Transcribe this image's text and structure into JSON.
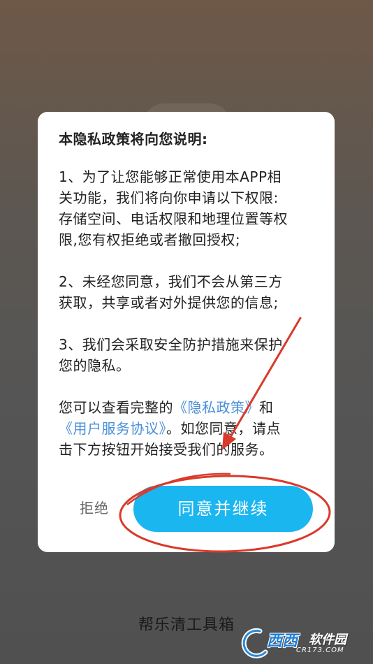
{
  "dialog": {
    "title": "本隐私政策将向您说明:",
    "item1_line1": "1、为了让您能够正常使用本APP相",
    "item1_line2": "关功能，我们将向你申请以下权限:",
    "item1_line3": "存储空间、电话权限和地理位置等权",
    "item1_line4": "限,您有权拒绝或者撤回授权;",
    "item2_line1": "2、未经您同意，我们不会从第三方",
    "item2_line2": "获取，共享或者对外提供您的信息;",
    "item3_line1": "3、我们会采取安全防护措施来保护",
    "item3_line2": "您的隐私。",
    "footer_prefix": "您可以查看完整的",
    "privacy_link": "《隐私政策》",
    "footer_and": "和",
    "user_agreement_link": "《用户服务协议》",
    "footer_suffix1": "。如您同意，请点",
    "footer_line3": "击下方按钮开始接受我们的服务。",
    "refuse_label": "拒绝",
    "agree_label": "同意并继续"
  },
  "app_name": "帮乐清工具箱",
  "watermark": {
    "brand": "西西",
    "name": "软件园",
    "domain": "CR173.COM"
  },
  "colors": {
    "accent": "#1ab6f0",
    "link": "#4a90d9",
    "annotation": "#d93a2b"
  }
}
